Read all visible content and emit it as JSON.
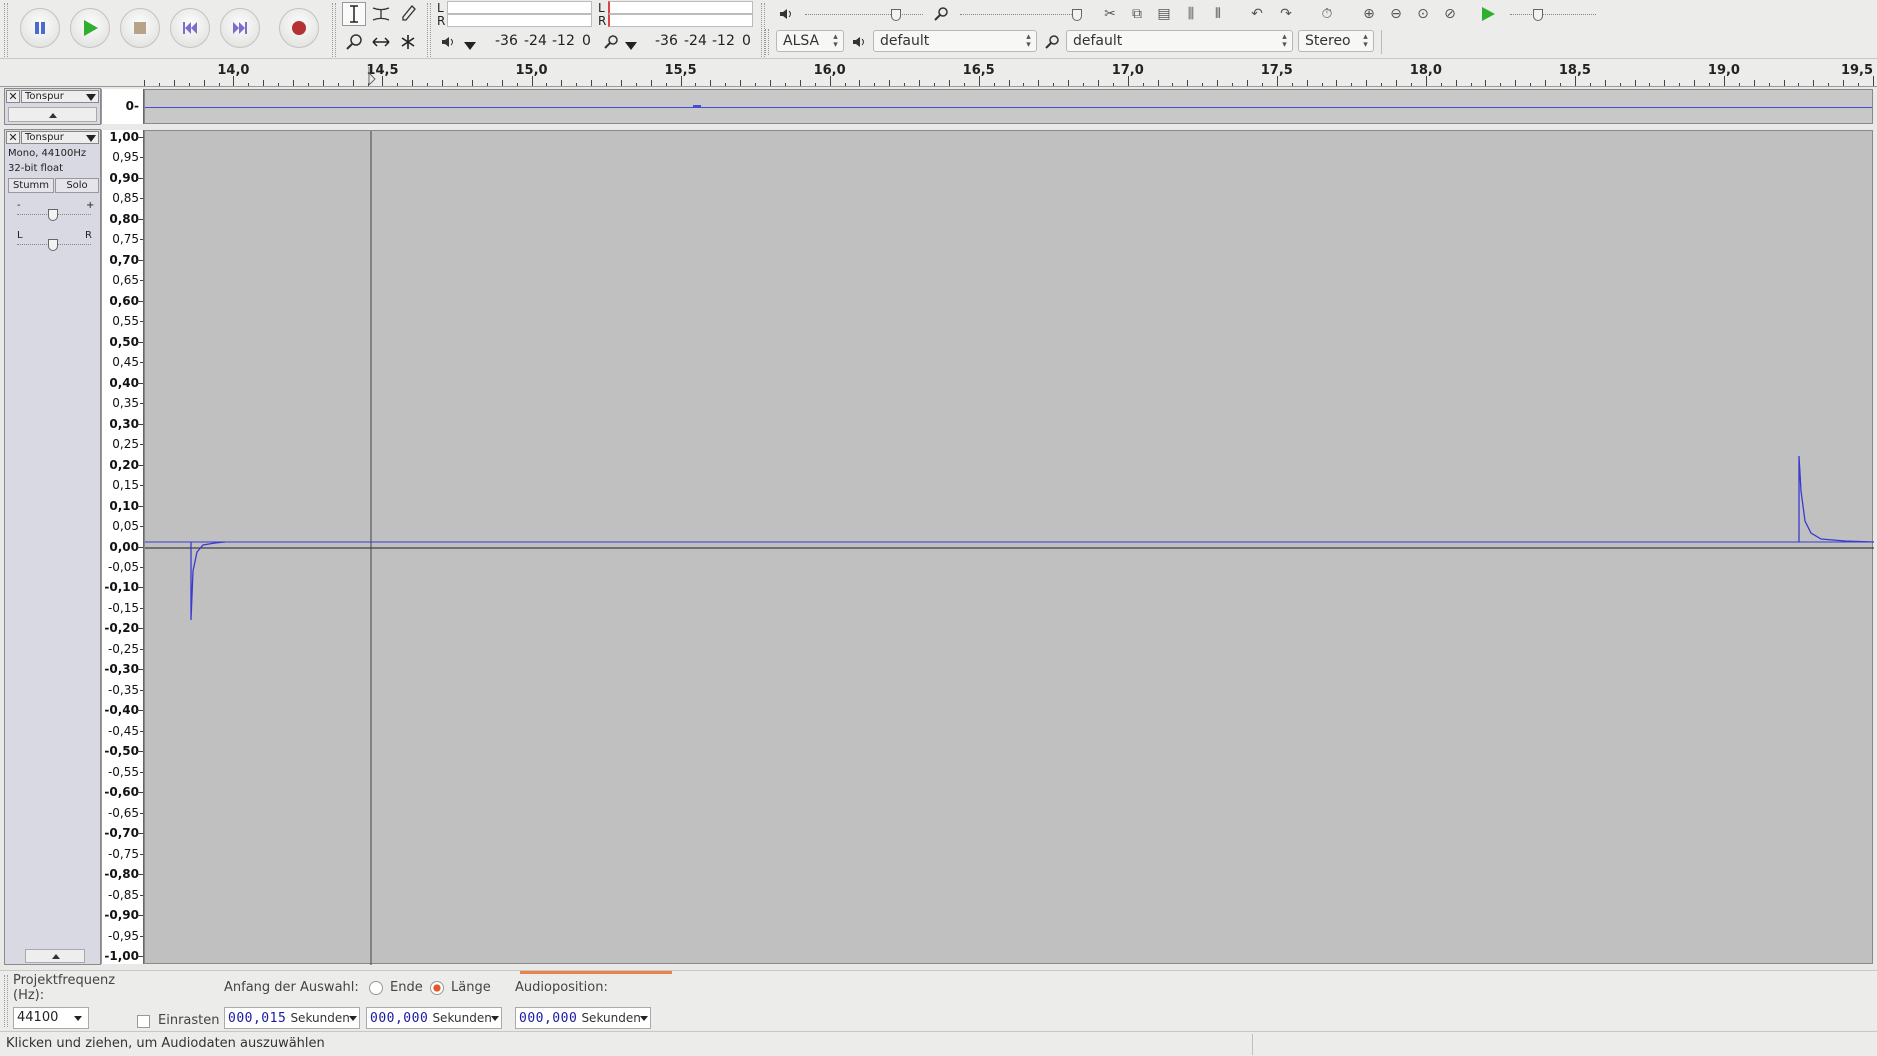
{
  "transport": {
    "pause_icon": "pause-icon",
    "play_icon": "play-icon",
    "stop_icon": "stop-icon",
    "skip_start_icon": "skip-start-icon",
    "skip_end_icon": "skip-end-icon",
    "record_icon": "record-icon",
    "colors": {
      "pause": "#4b6bd3",
      "play": "#2fae2f",
      "stop": "#b5a48a",
      "skip": "#7b6fc9",
      "record": "#b43232"
    }
  },
  "tools": {
    "select_icon": "i-beam-icon",
    "envelope_icon": "envelope-icon",
    "draw_icon": "pencil-icon",
    "zoom_icon": "zoom-icon",
    "timeshift_icon": "time-shift-icon",
    "multi_icon": "multi-tool-icon"
  },
  "meters": {
    "left_label": "L",
    "right_label": "R",
    "playback_scale": [
      "-36",
      "-24",
      "-12",
      "0"
    ],
    "record_scale": [
      "-36",
      "-24",
      "-12",
      "0"
    ]
  },
  "devices": {
    "host": "ALSA",
    "playback_device": "default",
    "record_device": "default",
    "channels": "Stereo"
  },
  "ruler": {
    "labels": [
      "14,0",
      "14,5",
      "15,0",
      "15,5",
      "16,0",
      "16,5",
      "17,0",
      "17,5",
      "18,0",
      "18,5",
      "19,0",
      "19,5"
    ],
    "start": 13.7,
    "end": 19.5
  },
  "track_mini": {
    "name": "Tonspur",
    "zero_label": "0-"
  },
  "track": {
    "name": "Tonspur",
    "info_rate": "Mono, 44100Hz",
    "info_format": "32-bit float",
    "mute_label": "Stumm",
    "solo_label": "Solo",
    "gain_minus": "-",
    "gain_plus": "+",
    "pan_left": "L",
    "pan_right": "R",
    "amplitude_labels": [
      "1,00",
      "0,95",
      "0,90",
      "0,85",
      "0,80",
      "0,75",
      "0,70",
      "0,65",
      "0,60",
      "0,55",
      "0,50",
      "0,45",
      "0,40",
      "0,35",
      "0,30",
      "0,25",
      "0,20",
      "0,15",
      "0,10",
      "0,05",
      "0,00",
      "-0,05",
      "-0,10",
      "-0,15",
      "-0,20",
      "-0,25",
      "-0,30",
      "-0,35",
      "-0,40",
      "-0,45",
      "-0,50",
      "-0,55",
      "-0,60",
      "-0,65",
      "-0,70",
      "-0,75",
      "-0,80",
      "-0,85",
      "-0,90",
      "-0,95",
      "-1,00"
    ],
    "wave_color": "#3a3ad0"
  },
  "selection": {
    "project_rate_label": "Projektfrequenz (Hz):",
    "project_rate_value": "44100",
    "snap_label": "Einrasten",
    "selection_start_label": "Anfang der Auswahl:",
    "end_label": "Ende",
    "length_label": "Länge",
    "audio_position_label": "Audioposition:",
    "start_value": "000,015",
    "length_value": "000,000",
    "position_value": "000,000",
    "unit": "Sekunden"
  },
  "status": {
    "message": "Klicken und ziehen, um Audiodaten auszuwählen"
  }
}
